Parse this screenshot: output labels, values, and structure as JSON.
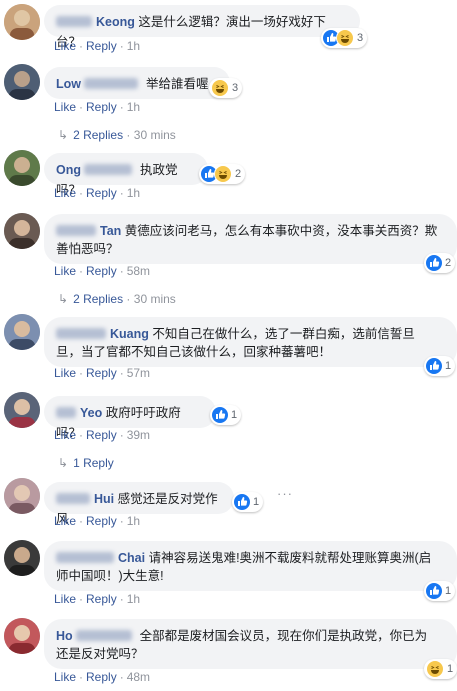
{
  "comments": [
    {
      "name": "Keong",
      "text": "这是什么逻辑？演出一场好戏好下台？",
      "reaction_count": "3",
      "like": "Like",
      "reply": "Reply",
      "time": "1h"
    },
    {
      "name": "Low",
      "text": "举给誰看喔",
      "reaction_count": "3",
      "like": "Like",
      "reply": "Reply",
      "time": "1h",
      "replies_label": "2 Replies",
      "replies_time": "30 mins"
    },
    {
      "name": "Ong",
      "text": "执政党吗？",
      "reaction_count": "2",
      "like": "Like",
      "reply": "Reply",
      "time": "1h"
    },
    {
      "name": "Tan",
      "text_line1": "黄德应该问老马，怎么有本事砍中资，没本事关西资？欺",
      "text_line2": "善怕恶吗？",
      "reaction_count": "2",
      "like": "Like",
      "reply": "Reply",
      "time": "58m",
      "replies_label": "2 Replies",
      "replies_time": "30 mins"
    },
    {
      "name": "Kuang",
      "text_line1": "不知自己在做什么，选了一群白痴，选前信誓旦",
      "text_line2": "旦，当了官都不知自己该做什么，回家种蕃薯吧！",
      "reaction_count": "1",
      "like": "Like",
      "reply": "Reply",
      "time": "57m"
    },
    {
      "name": "Yeo",
      "text": "政府吁吁政府吗？",
      "reaction_count": "1",
      "like": "Like",
      "reply": "Reply",
      "time": "39m",
      "replies_label": "1 Reply"
    },
    {
      "name": "Hui",
      "text": "感觉还是反对党作风",
      "reaction_count": "1",
      "like": "Like",
      "reply": "Reply",
      "time": "1h",
      "more": "···"
    },
    {
      "name": "Chai",
      "text_line1": "请神容易送鬼难!奥洲不载废料就帮处理账算奥洲(启",
      "text_line2": "师中国呗！)大生意!",
      "reaction_count": "1",
      "like": "Like",
      "reply": "Reply",
      "time": "1h"
    },
    {
      "name": "Ho",
      "text_line1": "全部都是废材国会议员，现在你们是执政党，你已为",
      "text_line2": "还是反对党吗？",
      "reaction_count": "1",
      "like": "Like",
      "reply": "Reply",
      "time": "48m"
    }
  ]
}
